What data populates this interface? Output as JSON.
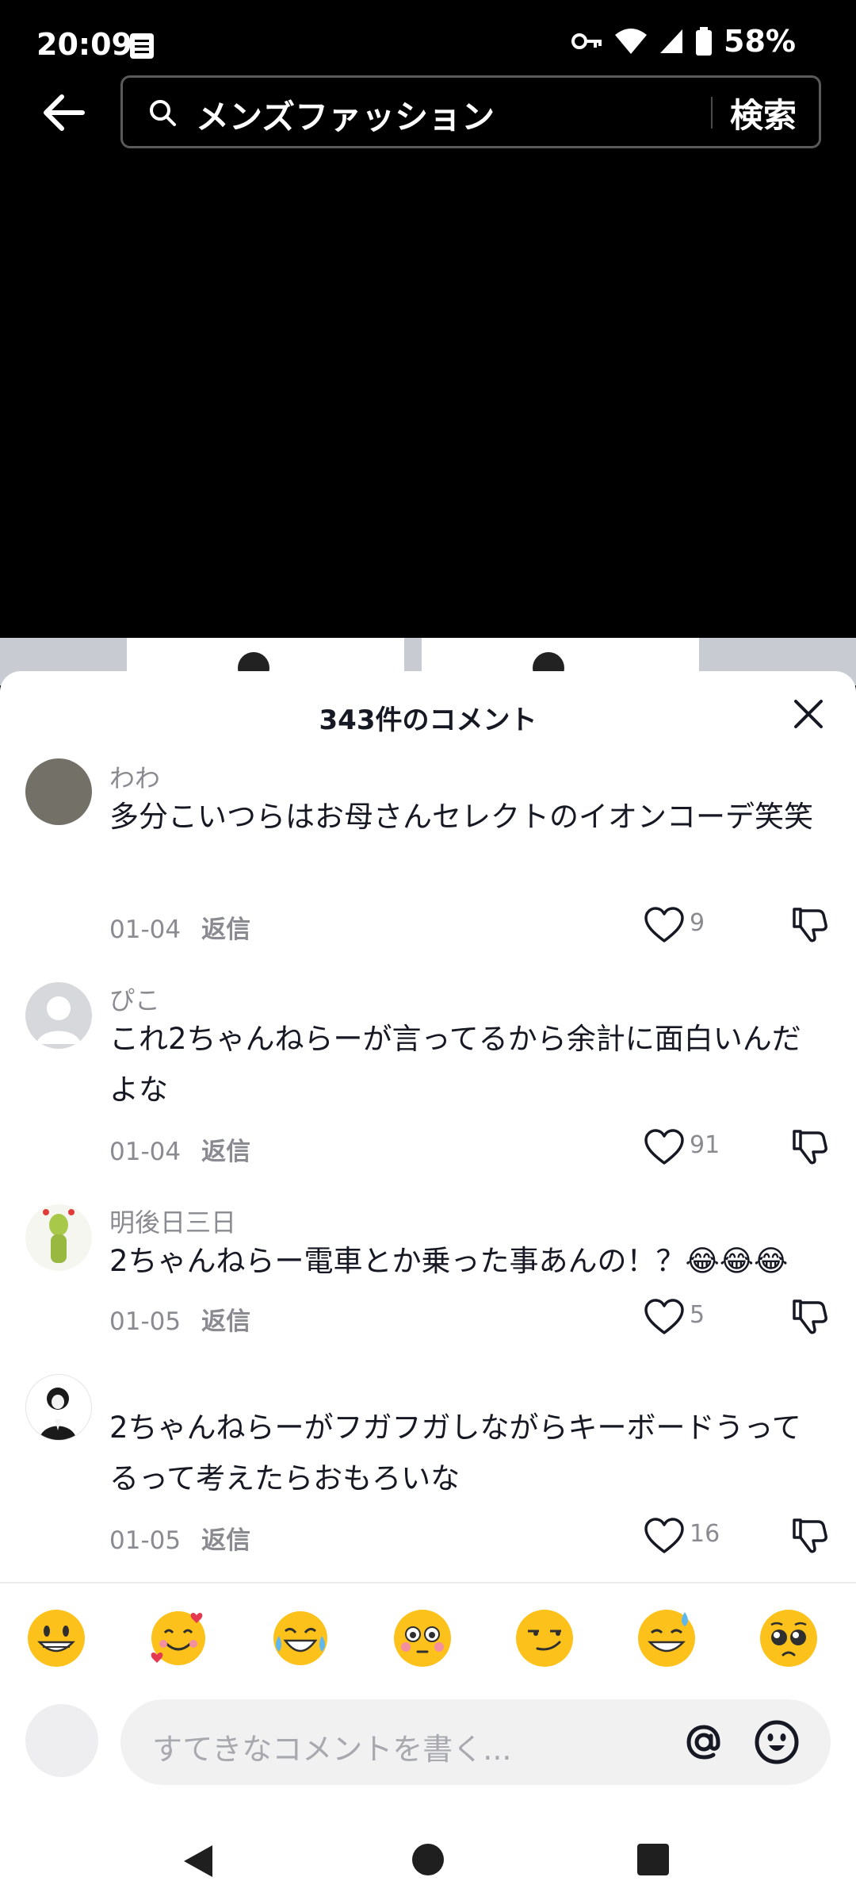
{
  "status_bar": {
    "time": "20:09",
    "battery": "58%",
    "icons": [
      "notification-icon",
      "vpn-key-icon",
      "wifi-icon",
      "signal-icon",
      "battery-icon"
    ]
  },
  "search": {
    "query": "メンズファッション",
    "submit_label": "検索"
  },
  "comments_sheet": {
    "title": "343件のコメント",
    "comments": [
      {
        "username": "わわ",
        "text": "多分こいつらはお母さんセレクトのイオンコーデ笑笑",
        "date": "01-04",
        "reply_label": "返信",
        "likes": "9"
      },
      {
        "username": "ぴこ",
        "text": "これ2ちゃんねらーが言ってるから余計に面白いんだよな",
        "date": "01-04",
        "reply_label": "返信",
        "likes": "91"
      },
      {
        "username": "明後日三日",
        "text": "2ちゃんねらー電車とか乗った事あんの！？😂😂😂",
        "date": "01-05",
        "reply_label": "返信",
        "likes": "5"
      },
      {
        "username": "",
        "text": "2ちゃんねらーがフガフガしながらキーボードうってるって考えたらおもろいな",
        "date": "01-05",
        "reply_label": "返信",
        "likes": "16"
      }
    ]
  },
  "emoji_bar": [
    "grinning-face",
    "smiling-face-with-hearts",
    "face-with-tears-of-joy",
    "flushed-face",
    "smirking-face",
    "grinning-face-with-sweat",
    "pleading-face"
  ],
  "composer": {
    "placeholder": "すてきなコメントを書く..."
  },
  "colors": {
    "background_top": "#000000",
    "sheet": "#ffffff",
    "muted_text": "#8a8b91",
    "input_bg": "#f1f1f2",
    "emoji_yellow": "#fcc21b"
  }
}
